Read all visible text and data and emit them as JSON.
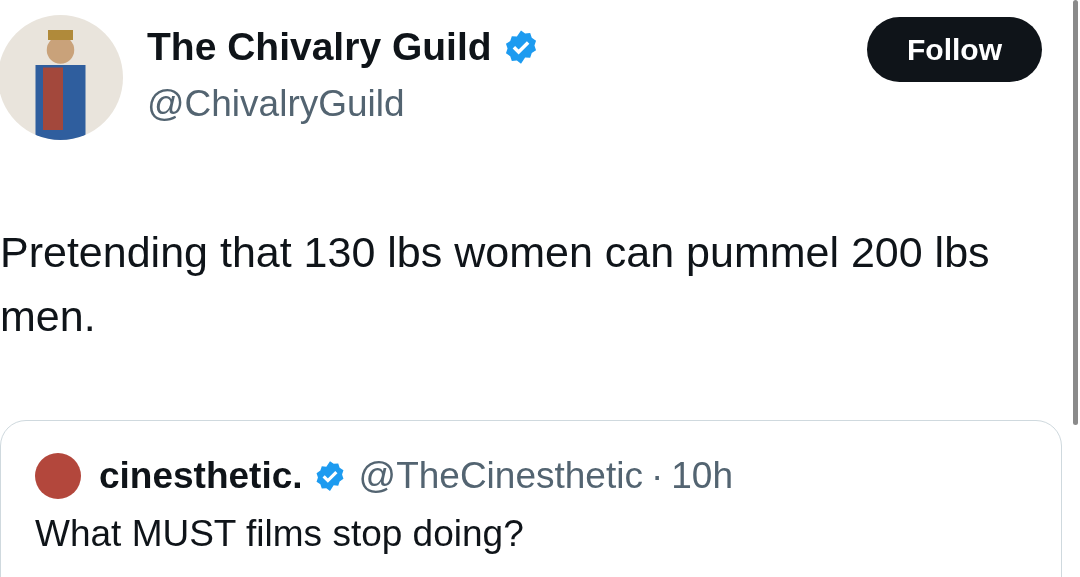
{
  "author": {
    "name": "The Chivalry Guild",
    "handle": "@ChivalryGuild",
    "verified": true
  },
  "follow_button": {
    "label": "Follow"
  },
  "tweet_text": "Pretending that 130 lbs women can pummel 200 lbs men.",
  "quoted_tweet": {
    "name": "cinesthetic.",
    "handle": "@TheCinesthetic",
    "separator": "·",
    "time": "10h",
    "verified": true,
    "text": "What MUST films stop doing?"
  }
}
